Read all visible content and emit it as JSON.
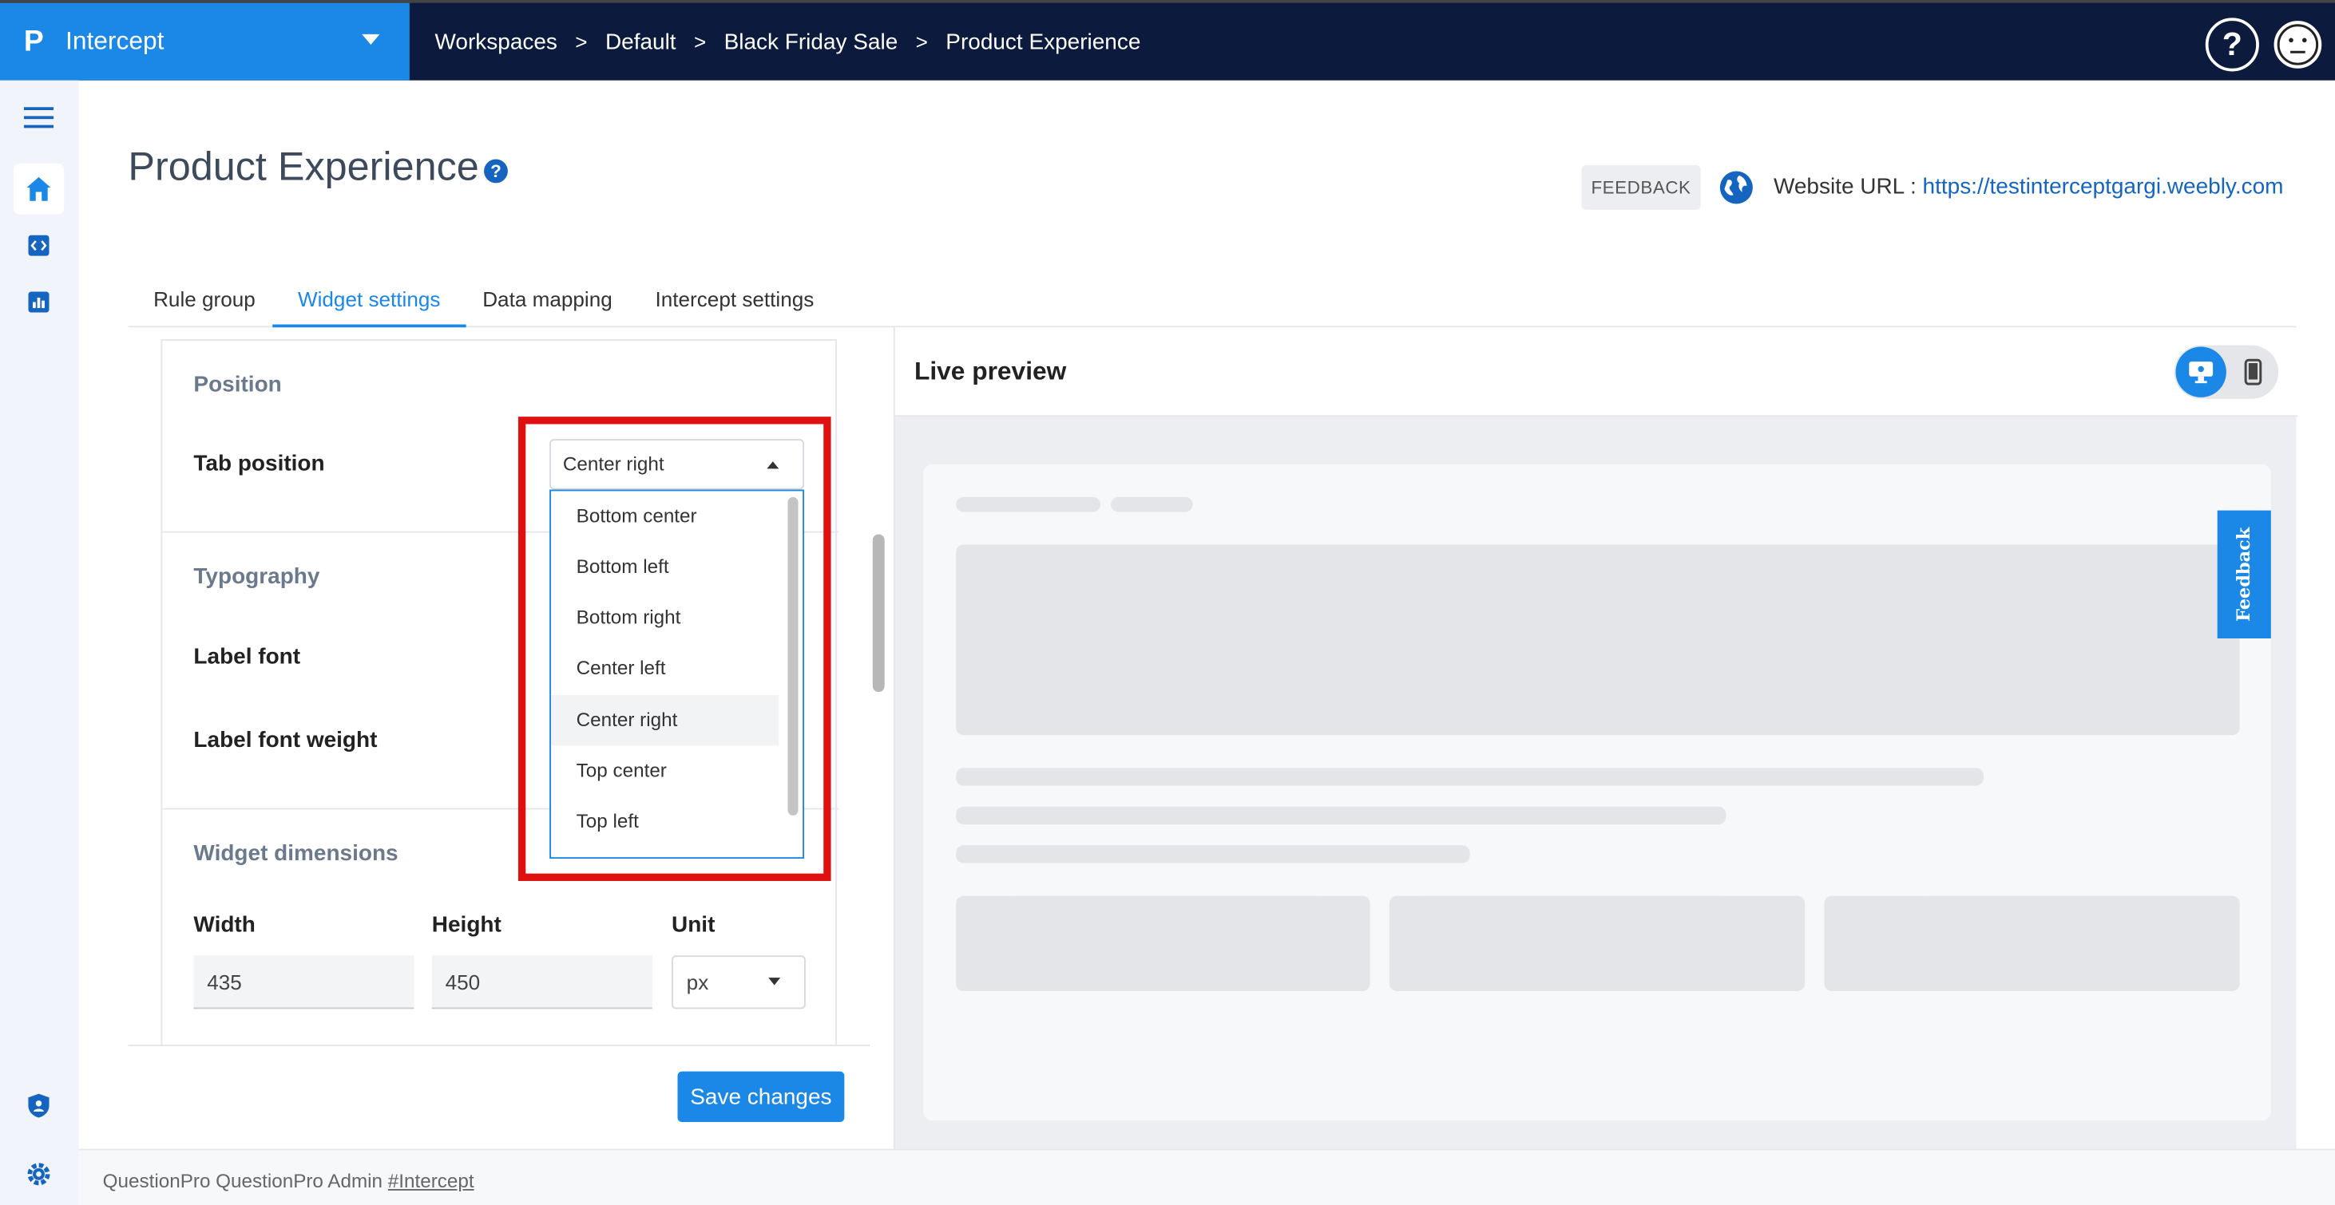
{
  "app": {
    "logo": "P",
    "name": "Intercept"
  },
  "breadcrumbs": [
    "Workspaces",
    "Default",
    "Black Friday Sale",
    "Product Experience"
  ],
  "breadcrumb_separator": ">",
  "header": {
    "help_icon": "?"
  },
  "rail": {
    "items": [
      "menu-icon",
      "home-icon",
      "code-icon",
      "chart-icon",
      "shield-user-icon",
      "gear-icon"
    ]
  },
  "page": {
    "title": "Product Experience",
    "title_help": "?",
    "feedback_chip": "FEEDBACK",
    "website_url_label": "Website URL :",
    "website_url": "https://testinterceptgargi.weebly.com"
  },
  "tabs": [
    {
      "label": "Rule group",
      "active": false
    },
    {
      "label": "Widget settings",
      "active": true
    },
    {
      "label": "Data mapping",
      "active": false
    },
    {
      "label": "Intercept settings",
      "active": false
    }
  ],
  "settings": {
    "position_section": "Position",
    "tab_position_label": "Tab position",
    "tab_position_value": "Center right",
    "tab_position_options": [
      "Bottom center",
      "Bottom left",
      "Bottom right",
      "Center left",
      "Center right",
      "Top center",
      "Top left"
    ],
    "typography_section": "Typography",
    "label_font": "Label font",
    "label_font_weight": "Label font weight",
    "dimensions_section": "Widget dimensions",
    "width_label": "Width",
    "width_value": "435",
    "height_label": "Height",
    "height_value": "450",
    "unit_label": "Unit",
    "unit_value": "px",
    "save_button": "Save changes"
  },
  "preview": {
    "title": "Live preview",
    "feedback_tab": "Feedback",
    "device_active": "desktop"
  },
  "footer": {
    "text": "QuestionPro  QuestionPro Admin",
    "link": "#Intercept"
  },
  "colors": {
    "brand": "#1b87e6",
    "topbar": "#0b1a3d",
    "highlight": "#e01010"
  }
}
